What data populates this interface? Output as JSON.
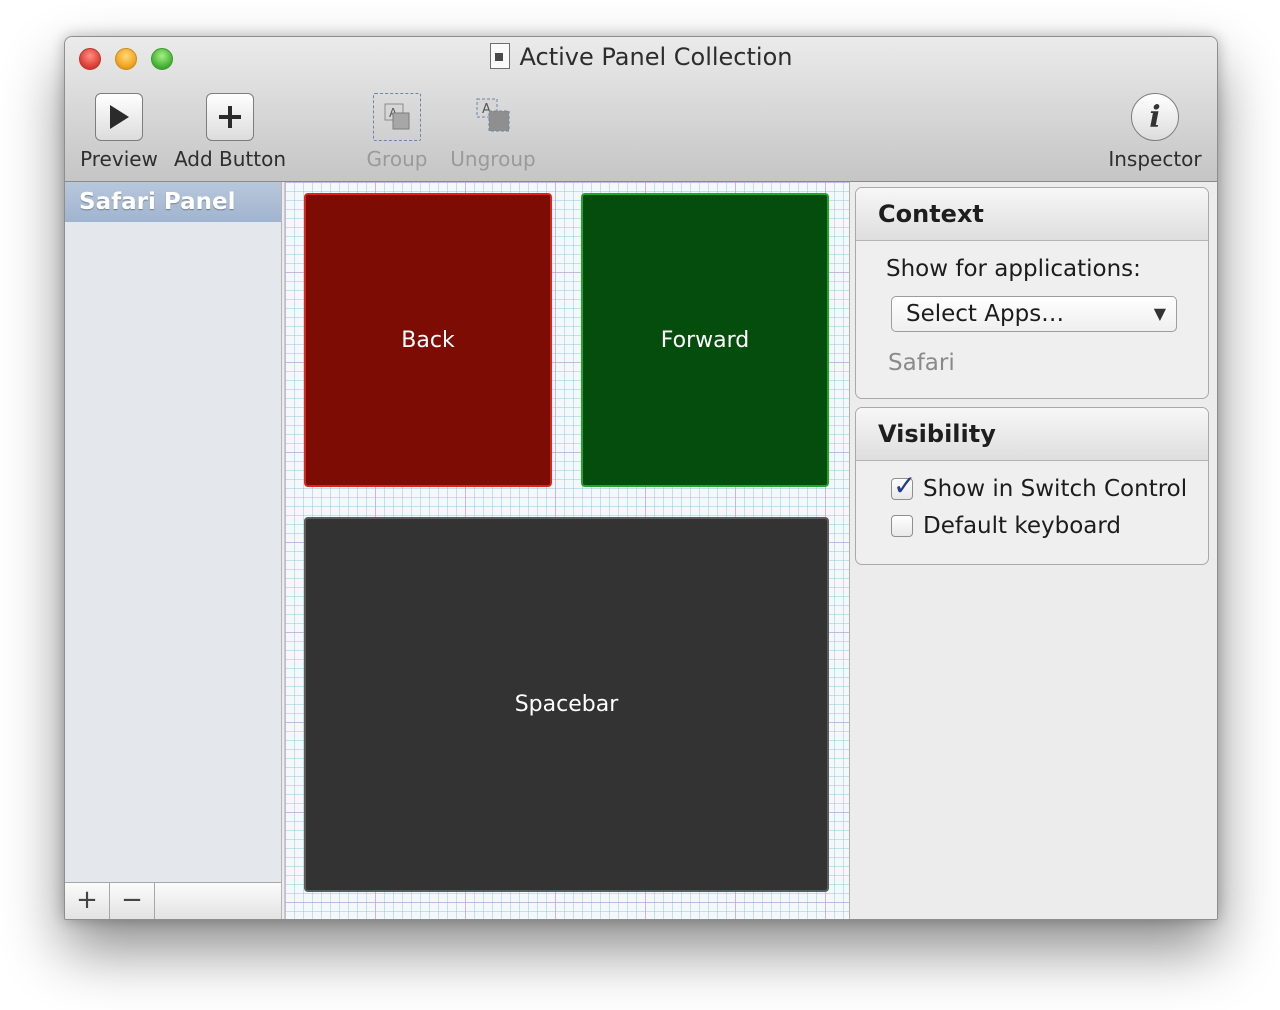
{
  "window": {
    "title": "Active Panel Collection"
  },
  "toolbar": {
    "preview_label": "Preview",
    "add_button_label": "Add Button",
    "group_label": "Group",
    "ungroup_label": "Ungroup",
    "inspector_label": "Inspector"
  },
  "sidebar": {
    "items": [
      {
        "label": "Safari Panel",
        "selected": true
      }
    ],
    "add_label": "+",
    "remove_label": "−"
  },
  "canvas": {
    "buttons": [
      {
        "label": "Back",
        "fill": "#7d0d04",
        "border": "#de2418"
      },
      {
        "label": "Forward",
        "fill": "#054d0d",
        "border": "#1ea62c"
      },
      {
        "label": "Spacebar",
        "fill": "#333333",
        "border": "#5c5c5c"
      }
    ]
  },
  "inspector": {
    "context": {
      "heading": "Context",
      "show_for_label": "Show for applications:",
      "select_value": "Select Apps…",
      "apps": [
        "Safari"
      ]
    },
    "visibility": {
      "heading": "Visibility",
      "options": [
        {
          "label": "Show in Switch Control",
          "checked": true
        },
        {
          "label": "Default keyboard",
          "checked": false
        }
      ]
    }
  },
  "icons": {
    "preview": "play-icon",
    "add_button": "plus-icon",
    "group": "group-icon",
    "ungroup": "ungroup-icon",
    "inspector": "info-icon"
  }
}
